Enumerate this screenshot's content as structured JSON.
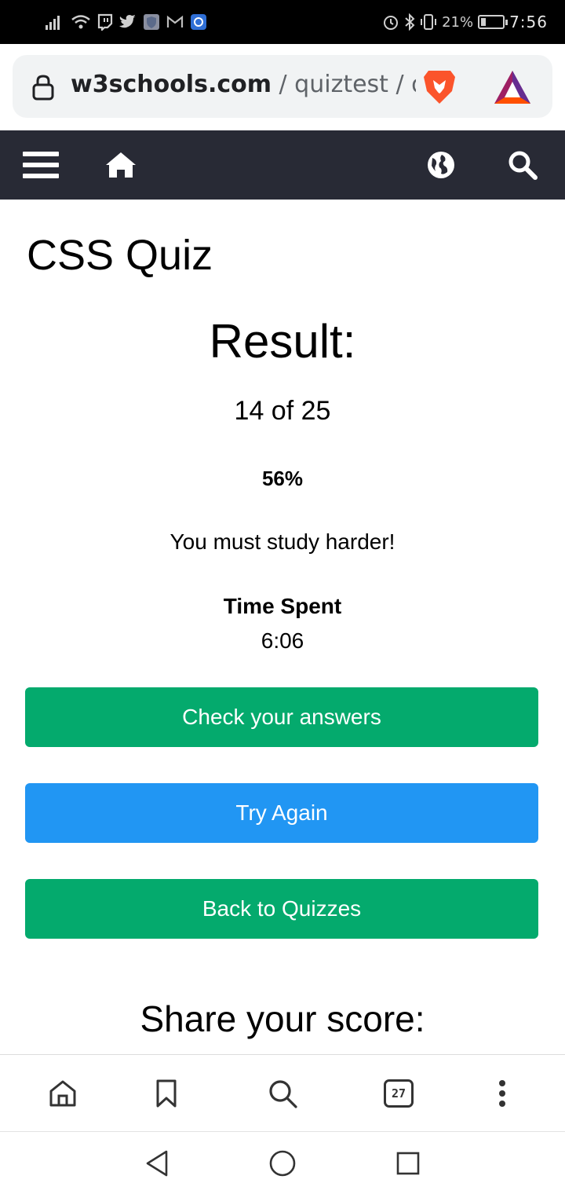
{
  "status_bar": {
    "battery_text": "21%",
    "battery_level": 0.21,
    "time": "7:56"
  },
  "address_bar": {
    "domain": "w3schools.com",
    "path": " / quiztest / qu"
  },
  "quiz": {
    "title": "CSS Quiz",
    "result_heading": "Result:",
    "score": "14 of 25",
    "percent": "56%",
    "message": "You must study harder!",
    "time_heading": "Time Spent",
    "time_value": "6:06",
    "check_answers_label": "Check your answers",
    "try_again_label": "Try Again",
    "back_label": "Back to Quizzes",
    "share_heading": "Share your score:"
  },
  "bottom_bar": {
    "tab_count": "27"
  },
  "colors": {
    "nav_bg": "#282a35",
    "green": "#04aa6d",
    "blue": "#2196f3"
  },
  "icons": [
    "signal-icon",
    "wifi-icon",
    "twitch-icon",
    "twitter-icon",
    "shield-app-icon",
    "gmail-icon",
    "app-icon",
    "alarm-icon",
    "bluetooth-icon",
    "vibrate-icon",
    "battery-icon",
    "lock-icon",
    "brave-lion-icon",
    "bat-triangle-icon",
    "menu-icon",
    "home-icon",
    "globe-icon",
    "search-icon",
    "bookmark-icon",
    "more-icon",
    "back-icon",
    "home-circle-icon",
    "recents-icon"
  ]
}
